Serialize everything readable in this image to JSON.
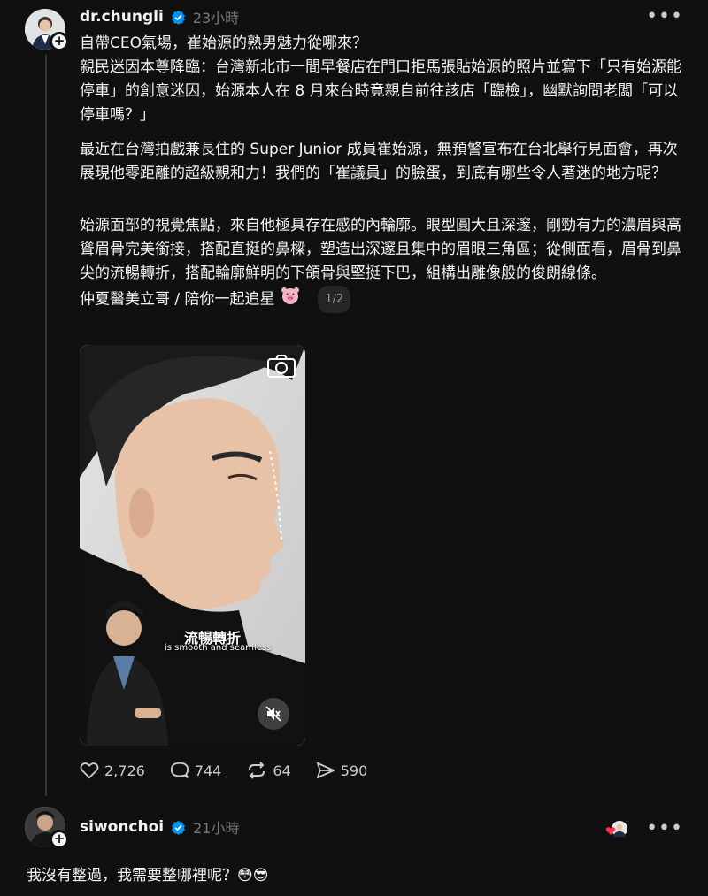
{
  "post": {
    "username": "dr.chungli",
    "timestamp": "23小時",
    "paragraph1_line1": "自帶CEO氣場，崔始源的熟男魅力從哪來？",
    "paragraph1_line2": "親民迷因本尊降臨：台灣新北市一間早餐店在門口拒馬張貼始源的照片並寫下「只有始源能停車」的創意迷因，始源本人在 8 月來台時竟親自前往該店「臨檢」，幽默詢問老闆「可以停車嗎？」",
    "paragraph2": "最近在台灣拍戲兼長住的 Super Junior 成員崔始源，無預警宣布在台北舉行見面會，再次展現他零距離的超級親和力！我們的「崔議員」的臉蛋，到底有哪些令人著迷的地方呢？",
    "paragraph3": "始源面部的視覺焦點，來自他極具存在感的內輪廓。眼型圓大且深邃，剛勁有力的濃眉與高聳眉骨完美銜接，搭配直挺的鼻樑，塑造出深邃且集中的眉眼三角區；從側面看，眉骨到鼻尖的流暢轉折，搭配輪廓鮮明的下頜骨與堅挺下巴，組構出雕像般的俊朗線條。",
    "signature": "仲夏醫美立哥 / 陪你一起追星",
    "page_indicator": "1/2",
    "media": {
      "caption_cn": "流暢轉折",
      "caption_en": "is smooth and seamless"
    },
    "actions": {
      "likes": "2,726",
      "comments": "744",
      "reposts": "64",
      "shares": "590"
    }
  },
  "reply": {
    "username": "siwonchoi",
    "timestamp": "21小時",
    "text": "我沒有整過，我需要整哪裡呢？😳😎"
  },
  "colors": {
    "background": "#101010",
    "text": "#f3f5f7",
    "muted": "#777777",
    "verified": "#0095f6"
  }
}
